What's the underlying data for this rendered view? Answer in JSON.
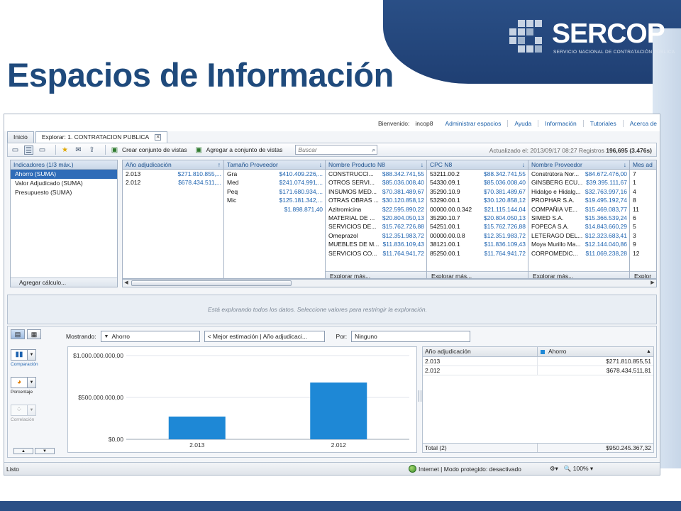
{
  "slide": {
    "title": "Espacios de Información",
    "logo_name": "SERCOP",
    "logo_subtitle": "SERVICIO NACIONAL DE CONTRATACIÓN PÚBLICA"
  },
  "app": {
    "topnav": {
      "welcome_label": "Bienvenido:",
      "user": "incop8",
      "links": [
        "Administrar espacios",
        "Ayuda",
        "Información",
        "Tutoriales",
        "Acerca de"
      ]
    },
    "tabs": [
      {
        "label": "Inicio"
      },
      {
        "label": "Explorar: 1. CONTRATACION PUBLICA"
      }
    ],
    "toolbar": {
      "create_set": "Crear conjunto de vistas",
      "add_to_set": "Agregar a conjunto de vistas",
      "search_placeholder": "Buscar",
      "updated_text": "Actualizado el: 2013/09/17 08:27 Registros",
      "record_count": "196,695",
      "timing": "(3.476s)"
    },
    "indicators": {
      "header": "Indicadores (1/3 máx.)",
      "items": [
        {
          "label": "Ahorro (SUMA)",
          "selected": true
        },
        {
          "label": "Valor Adjudicado (SUMA)",
          "selected": false
        },
        {
          "label": "Presupuesto (SUMA)",
          "selected": false
        }
      ],
      "footer": "Agregar cálculo..."
    },
    "dimensions": [
      {
        "header": "Año adjudicación",
        "rows": [
          {
            "k": "2.013",
            "v": "$271.810.855,..."
          },
          {
            "k": "2.012",
            "v": "$678.434.511,..."
          }
        ],
        "more": ""
      },
      {
        "header": "Tamaño Proveedor",
        "rows": [
          {
            "k": "Gra",
            "v": "$410.409.226,..."
          },
          {
            "k": "Med",
            "v": "$241.074.991,..."
          },
          {
            "k": "Peq",
            "v": "$171.680.934,..."
          },
          {
            "k": "Mic",
            "v": "$125.181.342,..."
          },
          {
            "k": "",
            "v": "$1.898.871,40"
          }
        ],
        "more": ""
      },
      {
        "header": "Nombre Producto N8",
        "rows": [
          {
            "k": "CONSTRUCCI...",
            "v": "$88.342.741,55"
          },
          {
            "k": "OTROS SERVI...",
            "v": "$85.036.008,40"
          },
          {
            "k": "INSUMOS MED...",
            "v": "$70.381.489,67"
          },
          {
            "k": "OTRAS OBRAS ...",
            "v": "$30.120.858,12"
          },
          {
            "k": "Azitromicina",
            "v": "$22.595.890,22"
          },
          {
            "k": "MATERIAL DE ...",
            "v": "$20.804.050,13"
          },
          {
            "k": "SERVICIOS DE...",
            "v": "$15.762.726,88"
          },
          {
            "k": "Omeprazol",
            "v": "$12.351.983,72"
          },
          {
            "k": "MUEBLES DE M...",
            "v": "$11.836.109,43"
          },
          {
            "k": "SERVICIOS CO...",
            "v": "$11.764.941,72"
          }
        ],
        "more": "Explorar más..."
      },
      {
        "header": "CPC N8",
        "rows": [
          {
            "k": "53211.00.2",
            "v": "$88.342.741,55"
          },
          {
            "k": "54330.09.1",
            "v": "$85.036.008,40"
          },
          {
            "k": "35290.10.9",
            "v": "$70.381.489,67"
          },
          {
            "k": "53290.00.1",
            "v": "$30.120.858,12"
          },
          {
            "k": "00000.00.0.342",
            "v": "$21.115.144,04"
          },
          {
            "k": "35290.10.7",
            "v": "$20.804.050,13"
          },
          {
            "k": "54251.00.1",
            "v": "$15.762.726,88"
          },
          {
            "k": "00000.00.0.8",
            "v": "$12.351.983,72"
          },
          {
            "k": "38121.00.1",
            "v": "$11.836.109,43"
          },
          {
            "k": "85250.00.1",
            "v": "$11.764.941,72"
          }
        ],
        "more": "Explorar más..."
      },
      {
        "header": "Nombre Proveedor",
        "rows": [
          {
            "k": "Constrútora Nor...",
            "v": "$84.672.476,00"
          },
          {
            "k": "GINSBERG ECU...",
            "v": "$39.395.111,67"
          },
          {
            "k": "Hidalgo e Hidalg...",
            "v": "$32.763.997,16"
          },
          {
            "k": "PROPHAR S.A.",
            "v": "$19.495.192,74"
          },
          {
            "k": "COMPAÑIA VE...",
            "v": "$15.469.083,77"
          },
          {
            "k": "SIMED S.A.",
            "v": "$15.366.539,24"
          },
          {
            "k": "FOPECA S.A.",
            "v": "$14.843.660,29"
          },
          {
            "k": "LETERAGO DEL...",
            "v": "$12.323.683,41"
          },
          {
            "k": "Moya Murillo Ma...",
            "v": "$12.144.040,86"
          },
          {
            "k": "CORPOMEDIC...",
            "v": "$11.069.238,28"
          }
        ],
        "more": "Explorar más..."
      },
      {
        "header": "Mes ad",
        "rows": [
          {
            "k": "7",
            "v": ""
          },
          {
            "k": "1",
            "v": ""
          },
          {
            "k": "4",
            "v": ""
          },
          {
            "k": "8",
            "v": ""
          },
          {
            "k": "11",
            "v": ""
          },
          {
            "k": "6",
            "v": ""
          },
          {
            "k": "5",
            "v": ""
          },
          {
            "k": "3",
            "v": ""
          },
          {
            "k": "9",
            "v": ""
          },
          {
            "k": "12",
            "v": ""
          }
        ],
        "more": "Explor"
      }
    ],
    "message": "Está explorando todos los datos. Seleccione valores para restringir la exploración.",
    "analysis": {
      "chart_types": [
        {
          "label": "Comparación",
          "icon": "bar-chart-icon",
          "enabled": true
        },
        {
          "label": "Porcentaje",
          "icon": "pie-chart-icon",
          "enabled": true
        },
        {
          "label": "Correlación",
          "icon": "scatter-chart-icon",
          "enabled": false
        }
      ],
      "showing_label": "Mostrando:",
      "showing_value": "Ahorro",
      "best_estimate": "< Mejor estimación | Año adjudicaci...",
      "by_label": "Por:",
      "by_value": "Ninguno"
    },
    "grid": {
      "col1": "Año adjudicación",
      "col2": "Ahorro",
      "rows": [
        {
          "k": "2.013",
          "v": "$271.810.855,51"
        },
        {
          "k": "2.012",
          "v": "$678.434.511,81"
        }
      ],
      "total_label": "Total (2)",
      "total_value": "$950.245.367,32"
    },
    "status": {
      "left": "Listo",
      "zone": "Internet | Modo protegido: desactivado",
      "zoom": "100%"
    }
  },
  "chart_data": {
    "type": "bar",
    "categories": [
      "2.013",
      "2.012"
    ],
    "values": [
      271810855.51,
      678434511.81
    ],
    "series": [
      {
        "name": "Ahorro",
        "values": [
          271810855.51,
          678434511.81
        ]
      }
    ],
    "title": "",
    "xlabel": "",
    "ylabel": "",
    "ylim": [
      0,
      1000000000
    ],
    "y_ticks": [
      0,
      500000000,
      1000000000
    ],
    "y_tick_labels": [
      "$0,00",
      "$500.000.000,00",
      "$1.000.000.000,00"
    ],
    "grid": true,
    "bar_color": "#1e88d6"
  }
}
